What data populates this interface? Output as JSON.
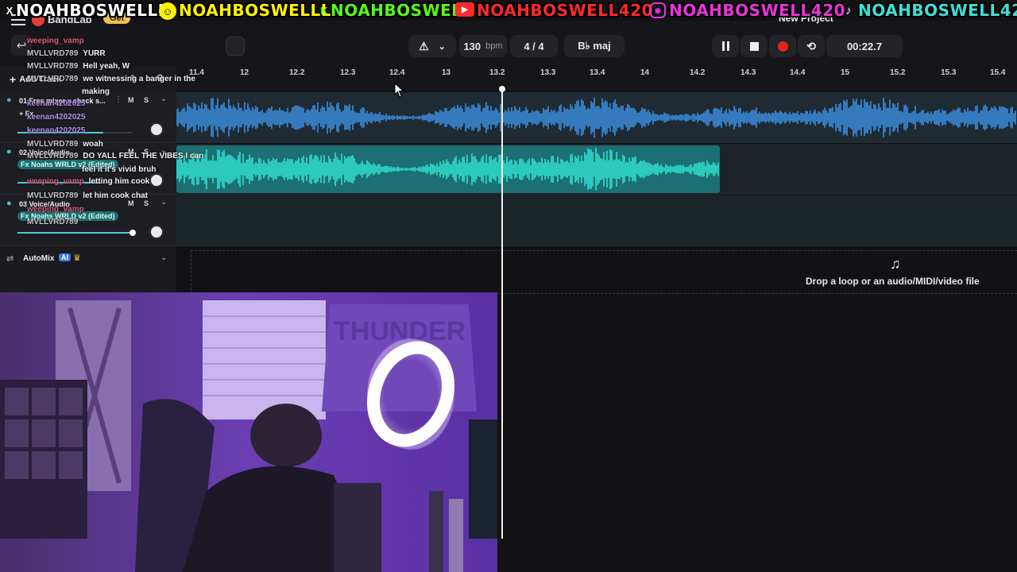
{
  "app": {
    "title": "BandLab",
    "get_badge": "Get",
    "project_title": "New Project"
  },
  "banner": {
    "x_handle": "NOAHBOSWELLL",
    "snap_handle": "NOAHBOSWELLL",
    "kick_handle": "NOAHBOSWELL",
    "yt_handle": "NOAHBOSWELL420",
    "ig_handle": "NOAHBOSWELL420",
    "tiktok_handle": "NOAHBOSWELL420",
    "colors": {
      "x": "#ffffff",
      "snap": "#fff200",
      "kick": "#53fc18",
      "yt": "#ff2a2a",
      "ig": "#e835d8",
      "tiktok": "#3de0d6"
    }
  },
  "transport": {
    "bpm_value": "130",
    "bpm_unit": "bpm",
    "time_signature": "4 / 4",
    "key": "B♭ maj",
    "time": "00:22.7"
  },
  "left_panel": {
    "add_track": "Add Track",
    "automix_label": "AutoMix",
    "ai_badge": "AI",
    "tracks": [
      {
        "name": "01 Free mixer x check s...",
        "m": "M",
        "s": "S",
        "fx": "+ Fx",
        "volume": 0.75
      },
      {
        "name": "02 Voice/Audio",
        "m": "M",
        "s": "S",
        "fx": "Fx Noahs WRLD v2 (Edited)",
        "volume": 0.72
      },
      {
        "name": "03 Voice/Audio",
        "m": "M",
        "s": "S",
        "fx": "Fx Noahs WRLD v2 (Edited)",
        "volume": 0.98
      }
    ]
  },
  "ruler": {
    "ticks": [
      "11.4",
      "12",
      "12.2",
      "12.3",
      "12.4",
      "13",
      "13.2",
      "13.3",
      "13.4",
      "14",
      "14.2",
      "14.3",
      "14.4",
      "15",
      "15.2",
      "15.3",
      "15.4"
    ]
  },
  "drop_zone": {
    "label": "Drop a loop or an audio/MIDI/video file"
  },
  "chat": [
    {
      "user": "weeping_vamp",
      "msg": ""
    },
    {
      "user": "MVLLVRD789",
      "msg": "YURR"
    },
    {
      "user": "MVLLVRD789",
      "msg": "Hell yeah, W"
    },
    {
      "user": "MVLLVRD789",
      "msg": "we witnessing a banger in the"
    },
    {
      "user": "",
      "msg": "making"
    },
    {
      "user": "keenan4202025",
      "msg": ""
    },
    {
      "user": "keenan4202025",
      "msg": ""
    },
    {
      "user": "keenan4202025",
      "msg": ""
    },
    {
      "user": "MVLLVRD789",
      "msg": "woah"
    },
    {
      "user": "MVLLVRD789",
      "msg": "DO YALL FEEL THE VIBES I can"
    },
    {
      "user": "",
      "msg": "feel it it's vivid bruh"
    },
    {
      "user": "weeping_vamp",
      "msg": "letting him cook"
    },
    {
      "user": "MVLLVRD789",
      "msg": "let him cook chat"
    },
    {
      "user": "weeping_vamp",
      "msg": ""
    },
    {
      "user": "MVLLVRD789",
      "msg": ""
    }
  ],
  "webcam": {
    "jersey_text": "THUNDER"
  }
}
